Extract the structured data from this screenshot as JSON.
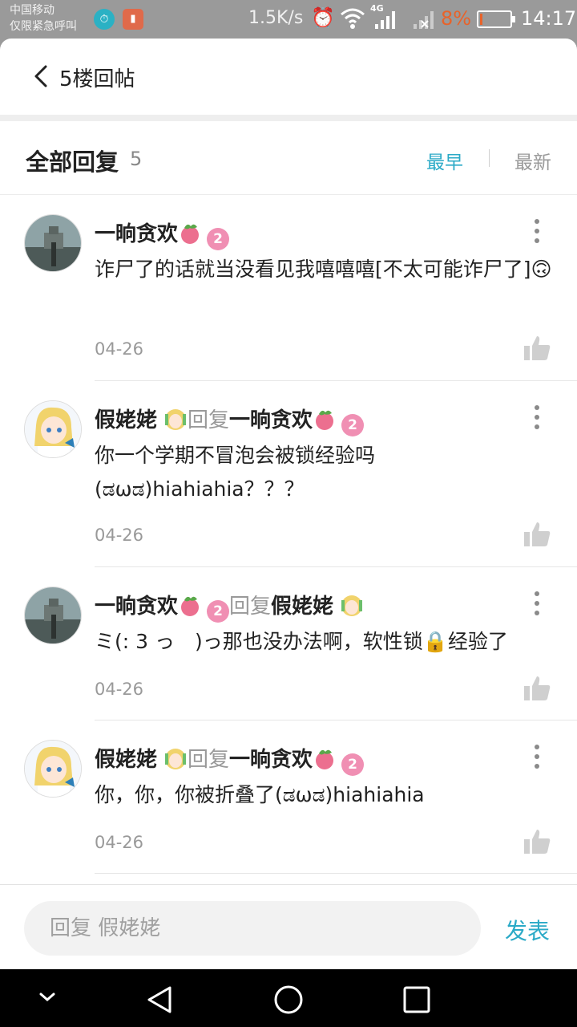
{
  "status_bar": {
    "carrier_line1": "中国移动",
    "carrier_line2": "仅限紧急呼叫",
    "net_speed": "1.5K/s",
    "network": "4G",
    "battery": "8%",
    "battery_level": 0.08,
    "time": "14:17",
    "app_icons": [
      "timer-icon",
      "battery-saver-icon"
    ]
  },
  "topbar": {
    "title": "5楼回帖"
  },
  "header": {
    "title": "全部回复",
    "count": "5",
    "sort_earliest": "最早",
    "sort_newest": "最新",
    "active_sort": "最早",
    "accent_color": "#2baac7"
  },
  "replies": [
    {
      "name": "一晌贪欢",
      "level": "2",
      "reply_label": "",
      "reply_to": "",
      "text": "诈尸了的话就当没看见我嘻嘻嘻[不太可能诈尸了]🙃",
      "date": "04-26",
      "avatar": "avatar-stone-statue"
    },
    {
      "name": "假姥姥",
      "level": "",
      "reply_label": "回复",
      "reply_to": "一晌贪欢",
      "reply_to_level": "2",
      "text": "你一个学期不冒泡会被锁经验吗(ಡωಡ)hiahiahia？？？",
      "date": "04-26",
      "avatar": "avatar-anime-girl"
    },
    {
      "name": "一晌贪欢",
      "level": "2",
      "reply_label": "回复",
      "reply_to": "假姥姥",
      "text": "ミ(: 3 っ　)っ那也没办法啊，软性锁🔒经验了",
      "date": "04-26",
      "avatar": "avatar-stone-statue"
    },
    {
      "name": "假姥姥",
      "level": "",
      "reply_label": "回复",
      "reply_to": "一晌贪欢",
      "reply_to_level": "2",
      "text": "你，你，你被折叠了(ಡωಡ)hiahiahia",
      "date": "04-26",
      "avatar": "avatar-anime-girl"
    }
  ],
  "composer": {
    "placeholder": "回复 假姥姥",
    "send_label": "发表"
  },
  "nav": [
    "chevron-down-icon",
    "back-triangle-icon",
    "home-circle-icon",
    "recent-square-icon"
  ]
}
